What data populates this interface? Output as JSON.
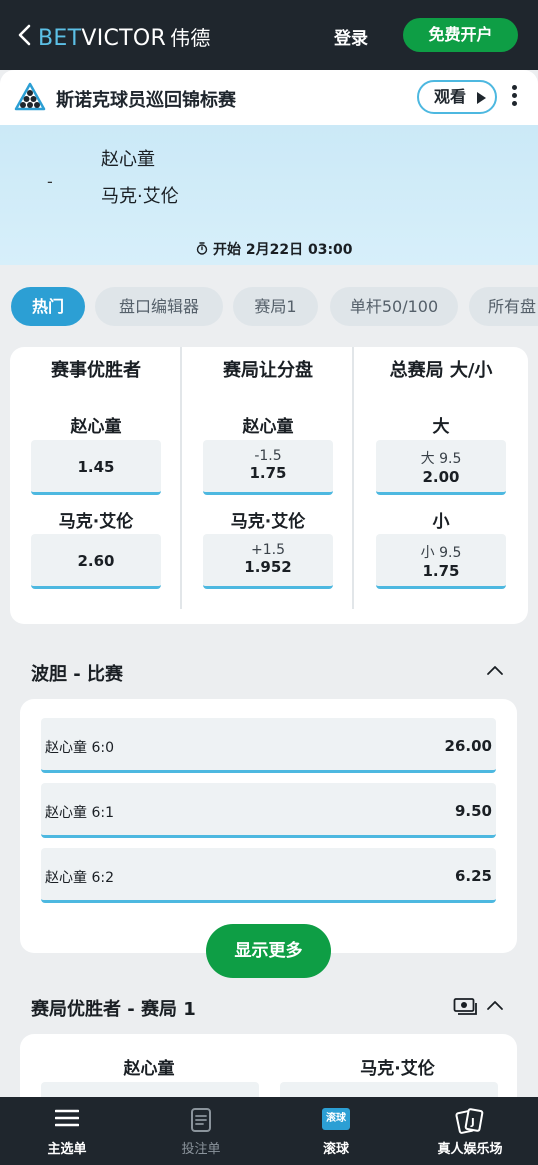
{
  "header": {
    "brand_bet": "BET",
    "brand_victor": "VICTOR",
    "brand_cn": "伟德",
    "login_label": "登录",
    "signup_label": "免费开户"
  },
  "event": {
    "title": "斯诺克球员巡回锦标赛",
    "watch_label": "观看"
  },
  "match": {
    "score": "-",
    "player1": "赵心童",
    "player2": "马克·艾伦",
    "start_label": "开始 2月22日 03:00"
  },
  "tabs": [
    "热门",
    "盘口编辑器",
    "赛局1",
    "单杆50/100",
    "所有盘口"
  ],
  "markets": {
    "winner": {
      "title": "赛事优胜者",
      "p1_label": "赵心童",
      "p1_price": "1.45",
      "p2_label": "马克·艾伦",
      "p2_price": "2.60"
    },
    "handicap": {
      "title": "赛局让分盘",
      "p1_label": "赵心童",
      "p1_line": "-1.5",
      "p1_price": "1.75",
      "p2_label": "马克·艾伦",
      "p2_line": "+1.5",
      "p2_price": "1.952"
    },
    "total": {
      "title": "总赛局 大/小",
      "over_label": "大",
      "over_line": "大 9.5",
      "over_price": "2.00",
      "under_label": "小",
      "under_line": "小 9.5",
      "under_price": "1.75"
    }
  },
  "correct_score": {
    "title": "波胆 - 比赛",
    "rows": [
      {
        "selection": "赵心童 6:0",
        "price": "26.00"
      },
      {
        "selection": "赵心童 6:1",
        "price": "9.50"
      },
      {
        "selection": "赵心童 6:2",
        "price": "6.25"
      }
    ],
    "more_label": "显示更多"
  },
  "frame_winner": {
    "title": "赛局优胜者 - 赛局 1",
    "p1": "赵心童",
    "p2": "马克·艾伦"
  },
  "bottom_nav": {
    "menu": "主选单",
    "betslip": "投注单",
    "inplay": "滚球",
    "inplay_badge": "滚球",
    "casino": "真人娱乐场"
  },
  "colors": {
    "accent_blue": "#4db8e0",
    "brand_green": "#0e9e45",
    "dark_bar": "#1f262d"
  }
}
